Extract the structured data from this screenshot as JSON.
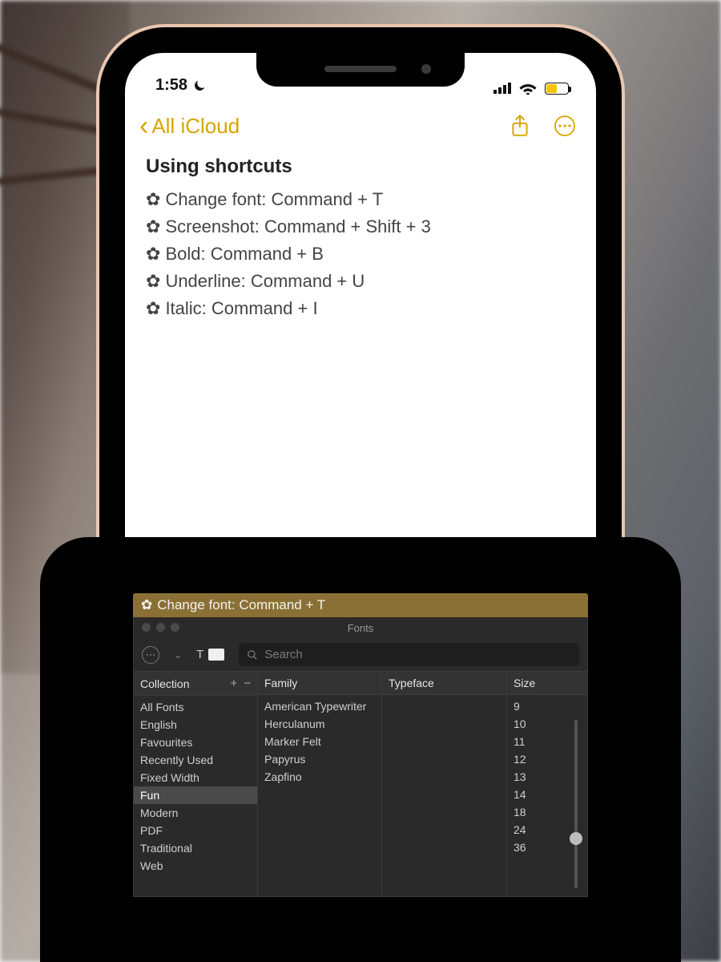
{
  "statusbar": {
    "time": "1:58",
    "moon_icon": "☾"
  },
  "nav": {
    "back_label": "All iCloud"
  },
  "note": {
    "title": "Using shortcuts",
    "bullet": "✿",
    "lines": [
      "Change font: Command + T",
      "Screenshot: Command + Shift + 3",
      "Bold: Command + B",
      "Underline: Command + U",
      "Italic: Command + I"
    ]
  },
  "panel": {
    "strip_text": "Change font: Command + T",
    "strip_bullet": "✿",
    "window_title": "Fonts",
    "search_placeholder": "Search",
    "text_preview_label": "T",
    "columns": {
      "collection_label": "Collection",
      "family_label": "Family",
      "typeface_label": "Typeface",
      "size_label": "Size"
    },
    "collections": [
      "All Fonts",
      "English",
      "Favourites",
      "Recently Used",
      "Fixed Width",
      "Fun",
      "Modern",
      "PDF",
      "Traditional",
      "Web"
    ],
    "collections_selected": "Fun",
    "families": [
      "American Typewriter",
      "Herculanum",
      "Marker Felt",
      "Papyrus",
      "Zapfino"
    ],
    "sizes": [
      "9",
      "10",
      "11",
      "12",
      "13",
      "14",
      "18",
      "24",
      "36"
    ]
  }
}
